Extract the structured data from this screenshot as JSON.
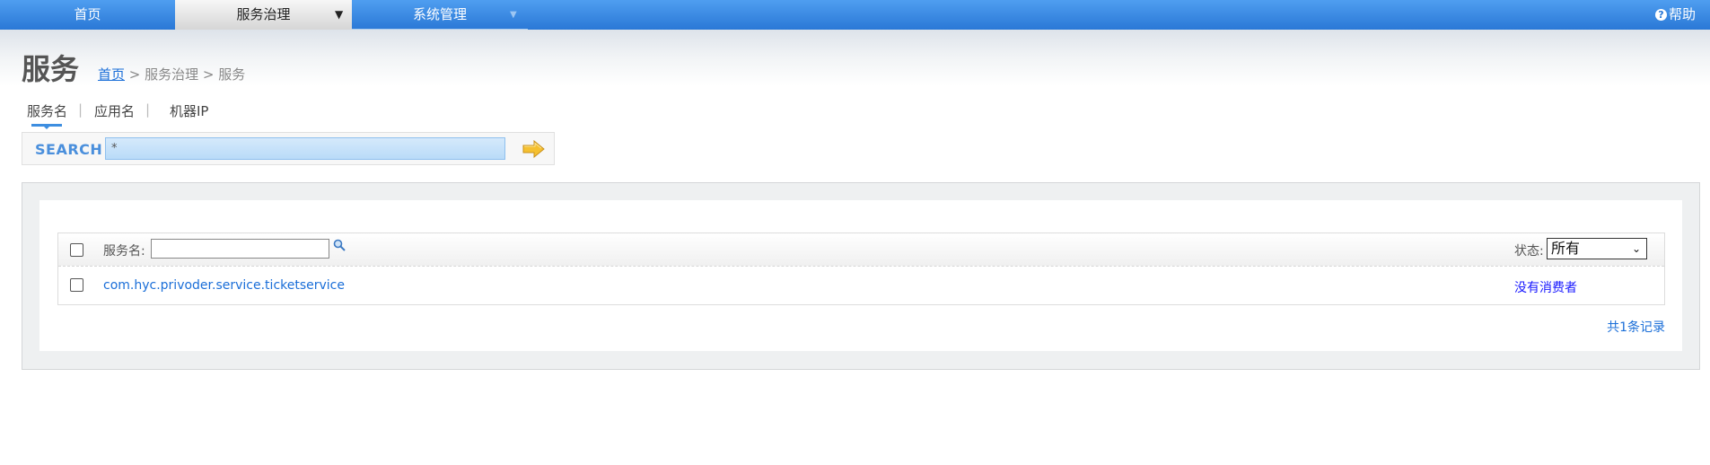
{
  "nav": {
    "items": [
      {
        "label": "首页"
      },
      {
        "label": "服务治理",
        "caret": "▼"
      },
      {
        "label": "系统管理",
        "caret": "▼"
      }
    ],
    "help": {
      "icon": "?",
      "label": "帮助"
    }
  },
  "page": {
    "title": "服务"
  },
  "breadcrumb": {
    "home": "首页",
    "sep1": " > ",
    "level2": "服务治理",
    "sep2": " > ",
    "current": "服务"
  },
  "search_tabs": {
    "tabs": [
      "服务名",
      "应用名",
      "机器IP"
    ],
    "separator": "|"
  },
  "search": {
    "label": "SEARCH",
    "value": "*"
  },
  "table": {
    "header": {
      "name_label": "服务名:",
      "name_filter_value": "",
      "status_label": "状态:",
      "status_selected": "所有",
      "status_caret": "⌄"
    },
    "rows": [
      {
        "service": "com.hyc.privoder.service.ticketservice",
        "status": "没有消费者"
      }
    ],
    "total": "共1条记录"
  },
  "colors": {
    "nav_blue": "#2a78d6",
    "link_blue": "#1a6ed8",
    "search_label": "#4a8fdc",
    "arrow_yellow": "#f5c030"
  }
}
